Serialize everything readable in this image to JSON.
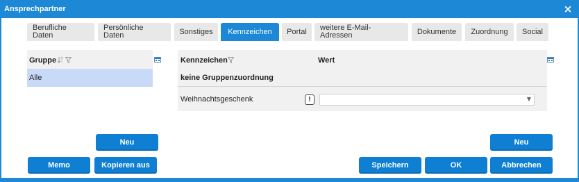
{
  "window": {
    "title": "Ansprechpartner",
    "close_glyph": "×"
  },
  "tabs": [
    {
      "label": "Berufliche\nDaten",
      "active": false
    },
    {
      "label": "Persönliche Daten",
      "active": false
    },
    {
      "label": "Sonstiges",
      "active": false
    },
    {
      "label": "Kennzeichen",
      "active": true
    },
    {
      "label": "Portal",
      "active": false
    },
    {
      "label": "weitere E-Mail-\nAdressen",
      "active": false
    },
    {
      "label": "Dokumente",
      "active": false
    },
    {
      "label": "Zuordnung",
      "active": false
    },
    {
      "label": "Social",
      "active": false
    }
  ],
  "group_panel": {
    "header": "Gruppe",
    "rows": [
      "Alle"
    ]
  },
  "kennzeichen_panel": {
    "col_kennzeichen": "Kennzeichen",
    "col_wert": "Wert",
    "group_label": "keine Gruppenzuordnung",
    "rows": [
      {
        "label": "Weihnachtsgeschenk",
        "required_glyph": "!",
        "value": ""
      }
    ]
  },
  "buttons": {
    "neu_left": "Neu",
    "neu_right": "Neu",
    "memo": "Memo",
    "kopieren": "Kopieren aus",
    "speichern": "Speichern",
    "ok": "OK",
    "abbrechen": "Abbrechen"
  },
  "colors": {
    "accent": "#1d89d6",
    "button": "#0f7fd4",
    "selected_row": "#c9daf8",
    "panel_bg": "#f1f1f1"
  },
  "icons": [
    "close-icon",
    "sort-icon",
    "filter-icon",
    "column-chooser-icon",
    "dropdown-arrow-icon",
    "required-icon"
  ]
}
